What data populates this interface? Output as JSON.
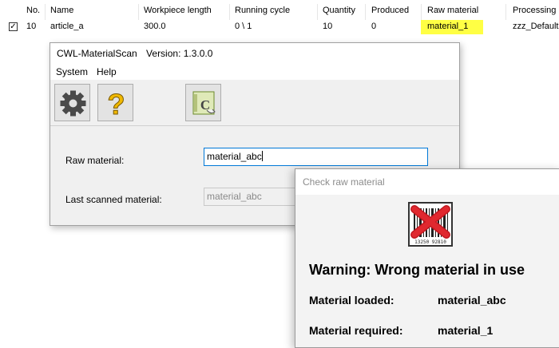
{
  "table": {
    "headers": [
      "No.",
      "Name",
      "Workpiece length",
      "Running cycle",
      "Quantity",
      "Produced",
      "Raw material",
      "Processing"
    ],
    "row": {
      "checked": true,
      "check_glyph": "✓",
      "no": "10",
      "name": "article_a",
      "workpiece_length": "300.0",
      "running_cycle": "0 \\ 1",
      "quantity": "10",
      "produced": "0",
      "raw_material": "material_1",
      "processing": "zzz_Default"
    },
    "highlight_color": "#ffff44"
  },
  "scan_window": {
    "title": "CWL-MaterialScan",
    "version": "Version: 1.3.0.0",
    "menu": [
      "System",
      "Help"
    ],
    "toolbar": {
      "settings_icon": "gear-icon",
      "help_icon": "question-mark-icon",
      "scan_icon": "material-scan-icon"
    },
    "raw_material_label": "Raw material:",
    "raw_material_value": "material_abc",
    "last_scanned_label": "Last scanned material:",
    "last_scanned_value": "material_abc",
    "accent_color": "#0078d7"
  },
  "warning_dialog": {
    "title": "Check raw material",
    "icon": "barcode-error-icon",
    "barcode_digits": "13250 92810",
    "heading": "Warning: Wrong material in use",
    "loaded_label": "Material loaded:",
    "loaded_value": "material_abc",
    "required_label": "Material required:",
    "required_value": "material_1",
    "error_color": "#e0282f"
  }
}
